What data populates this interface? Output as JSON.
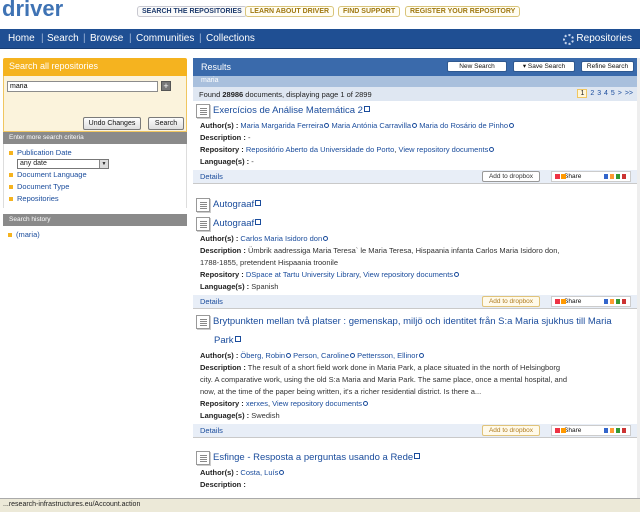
{
  "header": {
    "logo": "driver",
    "top_nav": [
      "SEARCH THE REPOSITORIES",
      "LEARN ABOUT DRIVER",
      "FIND SUPPORT",
      "REGISTER YOUR REPOSITORY"
    ]
  },
  "navbar": {
    "items": [
      "Home",
      "Search",
      "Browse",
      "Communities",
      "Collections"
    ],
    "separator": "|",
    "right": "Repositories"
  },
  "sidebar": {
    "search_title": "Search all repositories",
    "search_value": "maria",
    "plus": "+",
    "undo_label": "Undo Changes",
    "search_label": "Search",
    "criteria_title": "Enter more search criteria",
    "criteria": [
      "Publication Date",
      "Document Language",
      "Document Type",
      "Repositories"
    ],
    "date_value": "any date",
    "history_title": "Search history",
    "history": [
      "(maria)"
    ]
  },
  "results": {
    "title": "Results",
    "new_search": "New Search",
    "save_search": "Save Search",
    "refine_search": "Refine Search",
    "query": "maria",
    "found_prefix": "Found ",
    "found_count": "28986",
    "found_suffix": " documents, displaying page 1 of 2899",
    "pages": [
      "1",
      "2",
      "3",
      "4",
      "5",
      ">",
      ">>"
    ],
    "labels": {
      "authors": "Author(s) :",
      "description": "Description :",
      "repository": "Repository :",
      "language": "Language(s) :",
      "details": "Details",
      "dropbox": "Add to dropbox",
      "share": "Share"
    },
    "cards": [
      {
        "title": "Exercícios de Análise Matemática 2",
        "authors": [
          "Maria Margarida Ferreira",
          "Maria Antónia Carravilla",
          "Maria do Rosário de Pinho"
        ],
        "description": "-",
        "repository": "Repositório Aberto da Universidade do Porto",
        "view_repo": "View repository documents",
        "language": "-"
      },
      {
        "title": "Autograaf",
        "title2": "Autograaf",
        "authors": [
          "Carlos Maria Isidoro don"
        ],
        "description_1": "Ümbrik aadressiga Maria Teresa` le Maria Teresa, Hispaania infanta Carlos Maria Isidoro don,",
        "description_2": "1788-1855, pretendent Hispaania troonile",
        "repository": "DSpace at Tartu University Library",
        "view_repo": "View repository documents",
        "language": "Spanish"
      },
      {
        "title_1": "Brytpunkten mellan två platser : gemenskap, miljö och identitet från S:a Maria sjukhus till Maria",
        "title_2": "Park",
        "authors": [
          "Öberg, Robin",
          "Person, Caroline",
          "Pettersson, Ellinor"
        ],
        "description_1": "The result of a short field work done in Maria Park, a place situated in the north of Helsingborg",
        "description_2": "city. A comparative work, using the old S:a Maria and Maria Park. The same place, once a mental hospital, and",
        "description_3": "now, at the time of the paper being written, it's a richer residential district. Is there a...",
        "repository": "xerxes",
        "view_repo": "View repository documents",
        "language": "Swedish"
      },
      {
        "title": "Esfinge - Resposta a perguntas usando a Rede",
        "authors": [
          "Costa, Luís"
        ]
      }
    ]
  },
  "statusbar": {
    "text": "...research-infrastructures.eu/Account.action"
  }
}
